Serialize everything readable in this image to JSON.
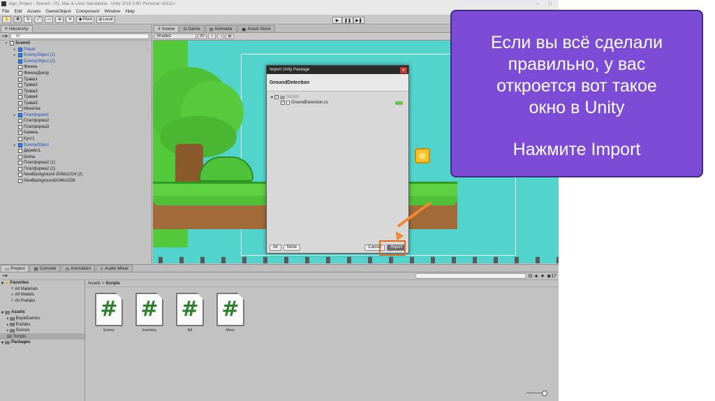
{
  "window": {
    "title": "Algo_Project - Scene3 - PC, Mac & Linux Standalone - Unity 2019.3.6f1 Personal <DX11>"
  },
  "menu": [
    "File",
    "Edit",
    "Assets",
    "GameObject",
    "Component",
    "Window",
    "Help"
  ],
  "toolbar": {
    "pivot": "Pivot",
    "local": "Local"
  },
  "hierarchy": {
    "tab": "Hierarchy",
    "search_placeholder": "All",
    "items": [
      {
        "label": "Scene3",
        "depth": 0,
        "type": "scene"
      },
      {
        "label": "Player",
        "depth": 1,
        "type": "prefab"
      },
      {
        "label": "EnemyObject (1)",
        "depth": 1,
        "type": "prefab"
      },
      {
        "label": "EnemyObject (2)",
        "depth": 1,
        "type": "prefab"
      },
      {
        "label": "Финиш",
        "depth": 1,
        "type": "object"
      },
      {
        "label": "ФинишДекор",
        "depth": 1,
        "type": "object"
      },
      {
        "label": "Трава1",
        "depth": 1,
        "type": "object"
      },
      {
        "label": "Трава2",
        "depth": 1,
        "type": "object"
      },
      {
        "label": "Трава3",
        "depth": 1,
        "type": "object"
      },
      {
        "label": "Трава4",
        "depth": 1,
        "type": "object"
      },
      {
        "label": "Трава5",
        "depth": 1,
        "type": "object"
      },
      {
        "label": "Монетка",
        "depth": 1,
        "type": "object"
      },
      {
        "label": "Платформа1",
        "depth": 1,
        "type": "prefab"
      },
      {
        "label": "Платформа2",
        "depth": 1,
        "type": "object"
      },
      {
        "label": "Платформа3",
        "depth": 1,
        "type": "object"
      },
      {
        "label": "Камень",
        "depth": 1,
        "type": "object"
      },
      {
        "label": "Куст1",
        "depth": 1,
        "type": "object"
      },
      {
        "label": "EnemyObject",
        "depth": 1,
        "type": "prefab"
      },
      {
        "label": "Дерево1",
        "depth": 1,
        "type": "object"
      },
      {
        "label": "Шипы",
        "depth": 1,
        "type": "object"
      },
      {
        "label": "Платформа2 (1)",
        "depth": 1,
        "type": "object"
      },
      {
        "label": "Платформа2 (2)",
        "depth": 1,
        "type": "object"
      },
      {
        "label": "NewBackground 2048x1024 (2)",
        "depth": 1,
        "type": "object"
      },
      {
        "label": "NewBackground2048x1536",
        "depth": 1,
        "type": "object"
      }
    ]
  },
  "scene_tabs": [
    "Scene",
    "Game",
    "Animator",
    "Asset Store"
  ],
  "scene_bar": {
    "shading": "Shaded",
    "mode": "2D"
  },
  "dialog": {
    "title": "Import Unity Package",
    "package": "GroundDetection",
    "folder": "Scripts",
    "file": "GroundDetection.cs",
    "btn_all": "All",
    "btn_none": "None",
    "btn_cancel": "Cancel",
    "btn_import": "Import"
  },
  "project": {
    "tabs": [
      "Project",
      "Console",
      "Animation",
      "Audio Mixer"
    ],
    "count": "17",
    "tree": [
      {
        "label": "Favorites",
        "kind": "header-fav"
      },
      {
        "label": "All Materials",
        "kind": "search"
      },
      {
        "label": "All Models",
        "kind": "search"
      },
      {
        "label": "All Prefabs",
        "kind": "search"
      },
      {
        "label": "Assets",
        "kind": "header"
      },
      {
        "label": "BayatGames",
        "kind": "folder"
      },
      {
        "label": "Prefabs",
        "kind": "folder"
      },
      {
        "label": "Scenes",
        "kind": "folder"
      },
      {
        "label": "Scripts",
        "kind": "folder-selected"
      },
      {
        "label": "Packages",
        "kind": "header"
      }
    ],
    "breadcrumb": [
      "Assets",
      ">",
      "Scripts"
    ],
    "assets": [
      "Enemy",
      "Inventory",
      "Kill",
      "Move"
    ],
    "asset_glyph": "#"
  },
  "callout": {
    "line1": "Если вы всё сделали",
    "line2": "правильно, у вас",
    "line3": "откроется вот такое",
    "line4": "окно в Unity",
    "line5": "Нажмите Import",
    "bg_color": "#7d4cd6"
  },
  "highlight_color": "#e36a1a"
}
